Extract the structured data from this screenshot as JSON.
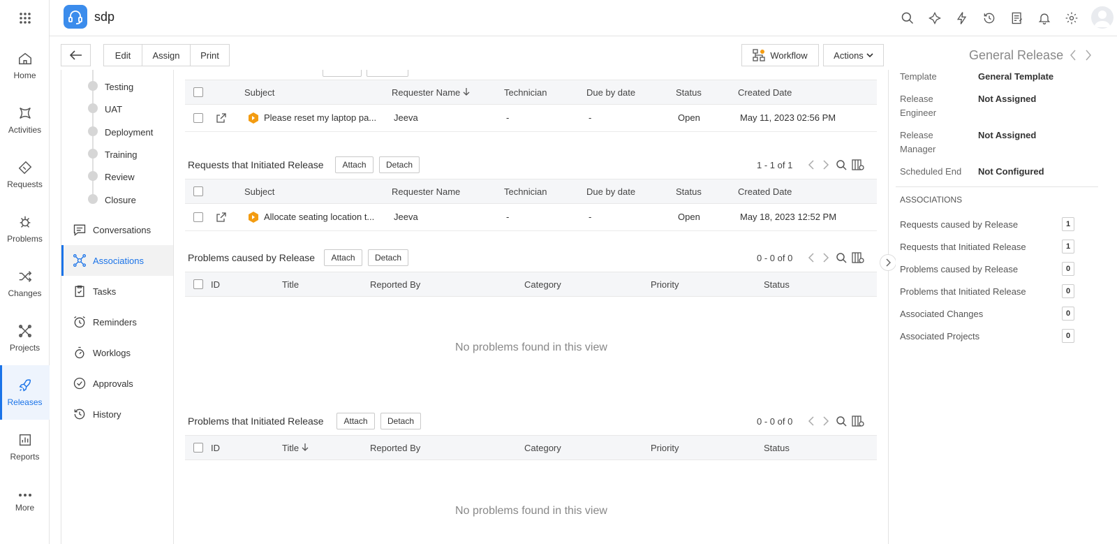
{
  "app": {
    "name": "sdp"
  },
  "nav": {
    "items": [
      {
        "label": "Home"
      },
      {
        "label": "Activities"
      },
      {
        "label": "Requests"
      },
      {
        "label": "Problems"
      },
      {
        "label": "Changes"
      },
      {
        "label": "Projects"
      },
      {
        "label": "Releases"
      },
      {
        "label": "Reports"
      },
      {
        "label": "More"
      }
    ]
  },
  "toolbar": {
    "edit": "Edit",
    "assign": "Assign",
    "print": "Print",
    "workflow": "Workflow",
    "actions": "Actions"
  },
  "release": {
    "title": "General Release"
  },
  "stages": [
    "Testing",
    "UAT",
    "Deployment",
    "Training",
    "Review",
    "Closure"
  ],
  "panel": {
    "items": [
      "Conversations",
      "Associations",
      "Tasks",
      "Reminders",
      "Worklogs",
      "Approvals",
      "History"
    ]
  },
  "sections": {
    "caused_requests": {
      "headers": [
        "Subject",
        "Requester Name",
        "Technician",
        "Due by date",
        "Status",
        "Created Date"
      ],
      "rows": [
        {
          "subject": "Please reset my laptop pa...",
          "requester": "Jeeva",
          "technician": "-",
          "due": "-",
          "status": "Open",
          "created": "May 11, 2023 02:56 PM"
        }
      ]
    },
    "initiated_requests": {
      "title": "Requests that Initiated Release",
      "attach": "Attach",
      "detach": "Detach",
      "pager": "1 - 1 of 1",
      "headers": [
        "Subject",
        "Requester Name",
        "Technician",
        "Due by date",
        "Status",
        "Created Date"
      ],
      "rows": [
        {
          "subject": "Allocate seating location t...",
          "requester": "Jeeva",
          "technician": "-",
          "due": "-",
          "status": "Open",
          "created": "May 18, 2023 12:52 PM"
        }
      ]
    },
    "caused_problems": {
      "title": "Problems caused by Release",
      "attach": "Attach",
      "detach": "Detach",
      "pager": "0 - 0 of 0",
      "headers": [
        "ID",
        "Title",
        "Reported By",
        "Category",
        "Priority",
        "Status"
      ],
      "empty": "No problems found in this view"
    },
    "initiated_problems": {
      "title": "Problems that Initiated Release",
      "attach": "Attach",
      "detach": "Detach",
      "pager": "0 - 0 of 0",
      "headers": [
        "ID",
        "Title",
        "Reported By",
        "Category",
        "Priority",
        "Status"
      ],
      "empty": "No problems found in this view"
    }
  },
  "details": [
    {
      "label": "Template",
      "value": "General Template"
    },
    {
      "label": "Release Engineer",
      "value": "Not Assigned"
    },
    {
      "label": "Release Manager",
      "value": "Not Assigned"
    },
    {
      "label": "Scheduled End",
      "value": "Not Configured"
    }
  ],
  "associations": {
    "heading": "ASSOCIATIONS",
    "items": [
      {
        "label": "Requests caused by Release",
        "count": "1"
      },
      {
        "label": "Requests that Initiated Release",
        "count": "1"
      },
      {
        "label": "Problems caused by Release",
        "count": "0"
      },
      {
        "label": "Problems that Initiated Release",
        "count": "0"
      },
      {
        "label": "Associated Changes",
        "count": "0"
      },
      {
        "label": "Associated Projects",
        "count": "0"
      }
    ]
  },
  "colors": {
    "accent": "#1a73e8",
    "ticket_icon": "#f39c12"
  }
}
